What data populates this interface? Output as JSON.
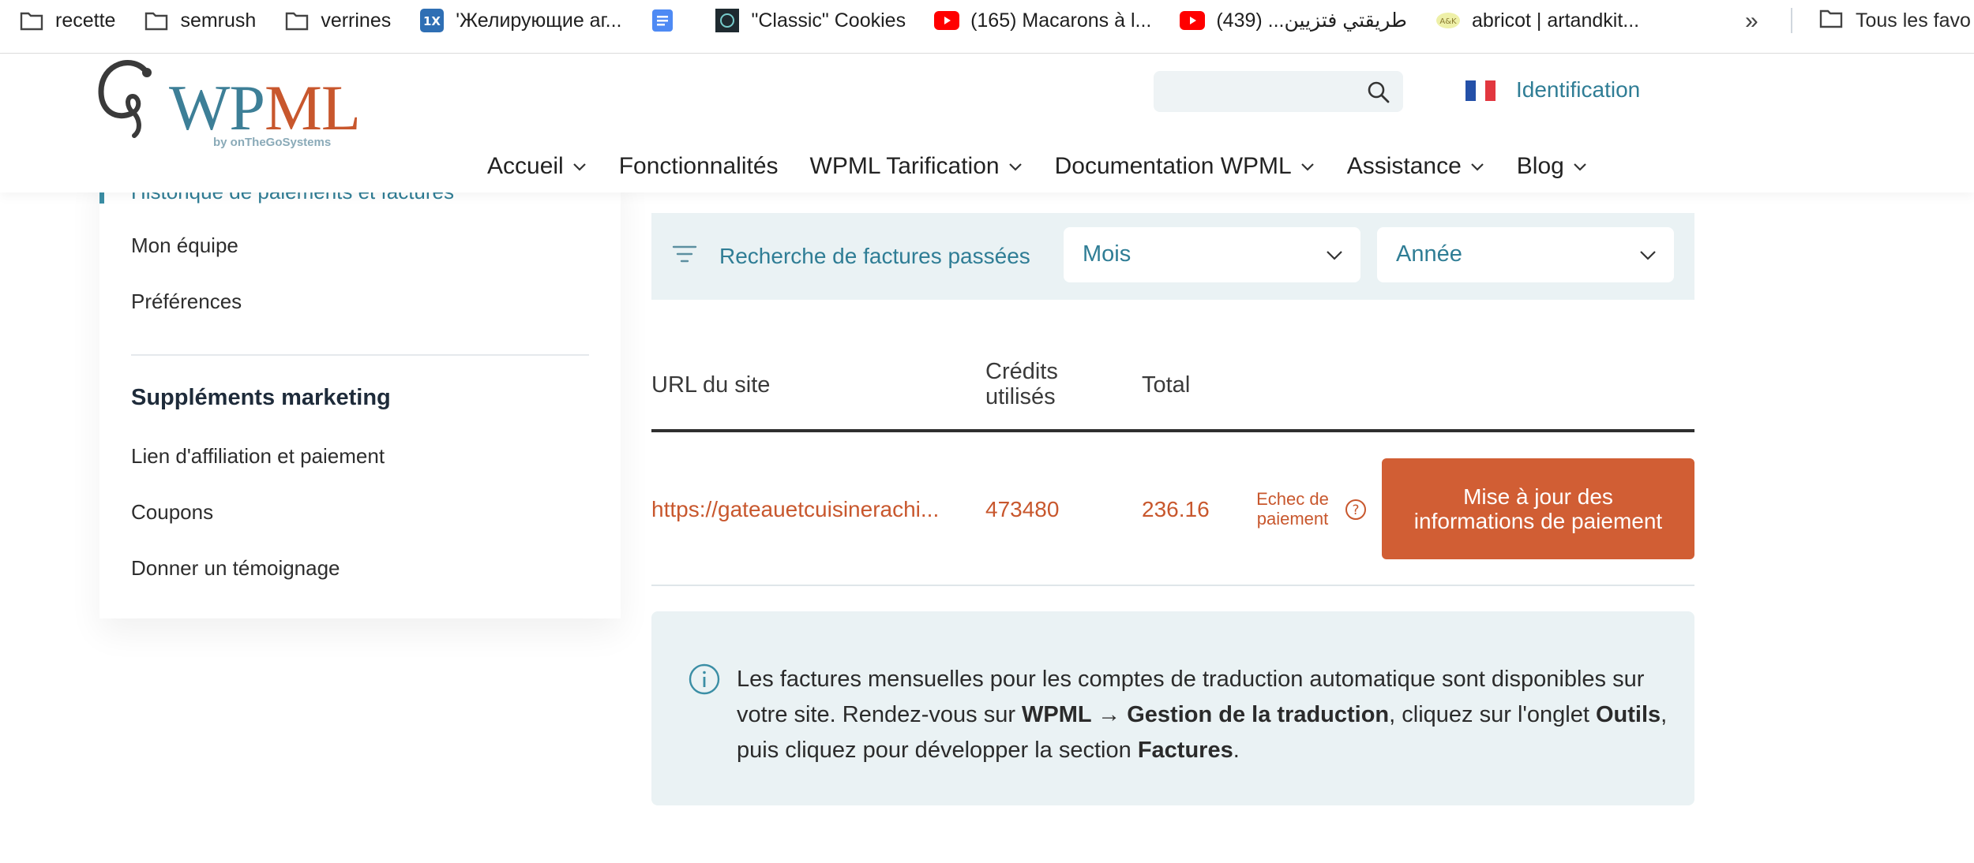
{
  "bookmarks": {
    "items": [
      {
        "label": "recette",
        "icon": "folder-icon"
      },
      {
        "label": "semrush",
        "icon": "folder-icon"
      },
      {
        "label": "verrines",
        "icon": "folder-icon"
      },
      {
        "label": "'Желирующие аг...",
        "icon": "site-icon-1x"
      },
      {
        "label": "",
        "icon": "google-docs-icon"
      },
      {
        "label": "\"Classic\" Cookies",
        "icon": "site-icon-cookies"
      },
      {
        "label": "(165) Macarons à l...",
        "icon": "youtube-icon"
      },
      {
        "label": "طريقتي فتزيين... (439)",
        "icon": "youtube-icon"
      },
      {
        "label": "abricot | artandkit...",
        "icon": "site-icon-artandkit"
      }
    ],
    "more": "»",
    "all_label": "Tous les favo"
  },
  "header": {
    "logo_text": "WPML",
    "logo_byline": "by onTheGoSystems",
    "login_label": "Identification",
    "nav": [
      {
        "label": "Accueil",
        "dropdown": true
      },
      {
        "label": "Fonctionnalités",
        "dropdown": false
      },
      {
        "label": "WPML Tarification",
        "dropdown": true
      },
      {
        "label": "Documentation WPML",
        "dropdown": true
      },
      {
        "label": "Assistance",
        "dropdown": true
      },
      {
        "label": "Blog",
        "dropdown": true
      }
    ]
  },
  "sidebar": {
    "active_item": "Historique de paiements et factures",
    "items": [
      "Mon équipe",
      "Préférences"
    ],
    "marketing_heading": "Suppléments marketing",
    "marketing_items": [
      "Lien d'affiliation et paiement",
      "Coupons",
      "Donner un témoignage"
    ]
  },
  "filter": {
    "label": "Recherche de factures passées",
    "month_value": "Mois",
    "year_value": "Année"
  },
  "table": {
    "headers": {
      "site_url": "URL du site",
      "credits_line1": "Crédits",
      "credits_line2": "utilisés",
      "total": "Total"
    },
    "row": {
      "site_url": "https://gateauetcuisinerachi...",
      "credits": "473480",
      "total": "236.16",
      "status_line1": "Echec de",
      "status_line2": "paiement",
      "action_label": "Mise à jour des informations de paiement"
    }
  },
  "info": {
    "text_1": "Les factures mensuelles pour les comptes de traduction automatique sont disponibles sur votre site. Rendez-vous sur ",
    "bold_1": "WPML → Gestion de la traduction",
    "text_2": ", cliquez sur l'onglet ",
    "bold_2": "Outils",
    "text_3": ", puis cliquez pour développer la section ",
    "bold_3": "Factures",
    "text_4": "."
  },
  "colors": {
    "accent": "#2f7d95",
    "danger": "#c8572d",
    "button": "#d15e34",
    "panel": "#eaf2f4"
  }
}
